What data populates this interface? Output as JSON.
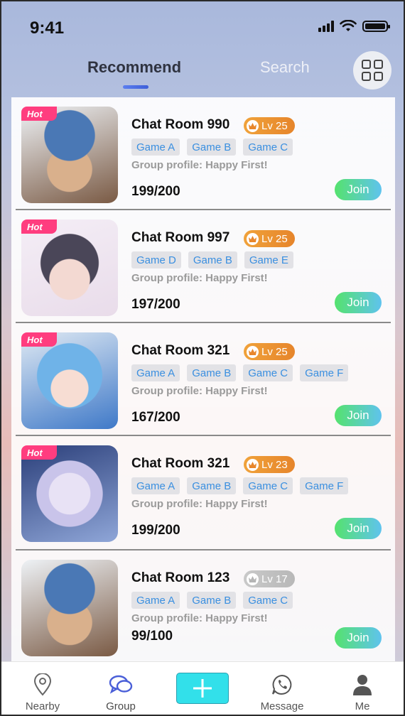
{
  "status_bar": {
    "time": "9:41"
  },
  "tabs": {
    "recommend": "Recommend",
    "search": "Search"
  },
  "rooms": [
    {
      "hot": "Hot",
      "title": "Chat Room 990",
      "level": "Lv 25",
      "level_style": "gold",
      "tags": [
        "Game A",
        "Game B",
        "Game C"
      ],
      "profile": "Group profile: Happy First!",
      "members": "199/200",
      "join": "Join",
      "avatar_colors": [
        "#4a78b5",
        "#d9b08c",
        "#7a5a44"
      ]
    },
    {
      "hot": "Hot",
      "title": "Chat Room 997",
      "level": "Lv 25",
      "level_style": "gold",
      "tags": [
        "Game D",
        "Game B",
        "Game E"
      ],
      "profile": "Group profile: Happy First!",
      "members": "197/200",
      "join": "Join",
      "avatar_colors": [
        "#e9dcea",
        "#4a4658",
        "#f3d9d2"
      ]
    },
    {
      "hot": "Hot",
      "title": "Chat Room 321",
      "level": "Lv 25",
      "level_style": "gold",
      "tags": [
        "Game A",
        "Game B",
        "Game C",
        "Game F"
      ],
      "profile": "Group profile: Happy First!",
      "members": "167/200",
      "join": "Join",
      "avatar_colors": [
        "#6fb3e8",
        "#3f79c8",
        "#f7ddd3"
      ]
    },
    {
      "hot": "Hot",
      "title": "Chat Room 321",
      "level": "Lv 23",
      "level_style": "gold",
      "tags": [
        "Game A",
        "Game B",
        "Game C",
        "Game F"
      ],
      "profile": "Group profile: Happy First!",
      "members": "199/200",
      "join": "Join",
      "avatar_colors": [
        "#2b3f7a",
        "#c9c4ea",
        "#e8e2f5"
      ]
    },
    {
      "hot": "",
      "title": "Chat Room 123",
      "level": "Lv 17",
      "level_style": "grey",
      "tags": [
        "Game A",
        "Game B",
        "Game C"
      ],
      "profile": "Group profile: Happy First!",
      "members": "99/100",
      "join": "Join",
      "avatar_colors": [
        "#4a78b5",
        "#d9b08c",
        "#7a5a44"
      ]
    }
  ],
  "bottom_nav": {
    "nearby": "Nearby",
    "group": "Group",
    "message": "Message",
    "me": "Me"
  },
  "colors": {
    "hot_badge": "#ff3d7f",
    "tag_text": "#3a8fe0",
    "add_button": "#32e0ea",
    "active_icon": "#4a5fd8"
  }
}
